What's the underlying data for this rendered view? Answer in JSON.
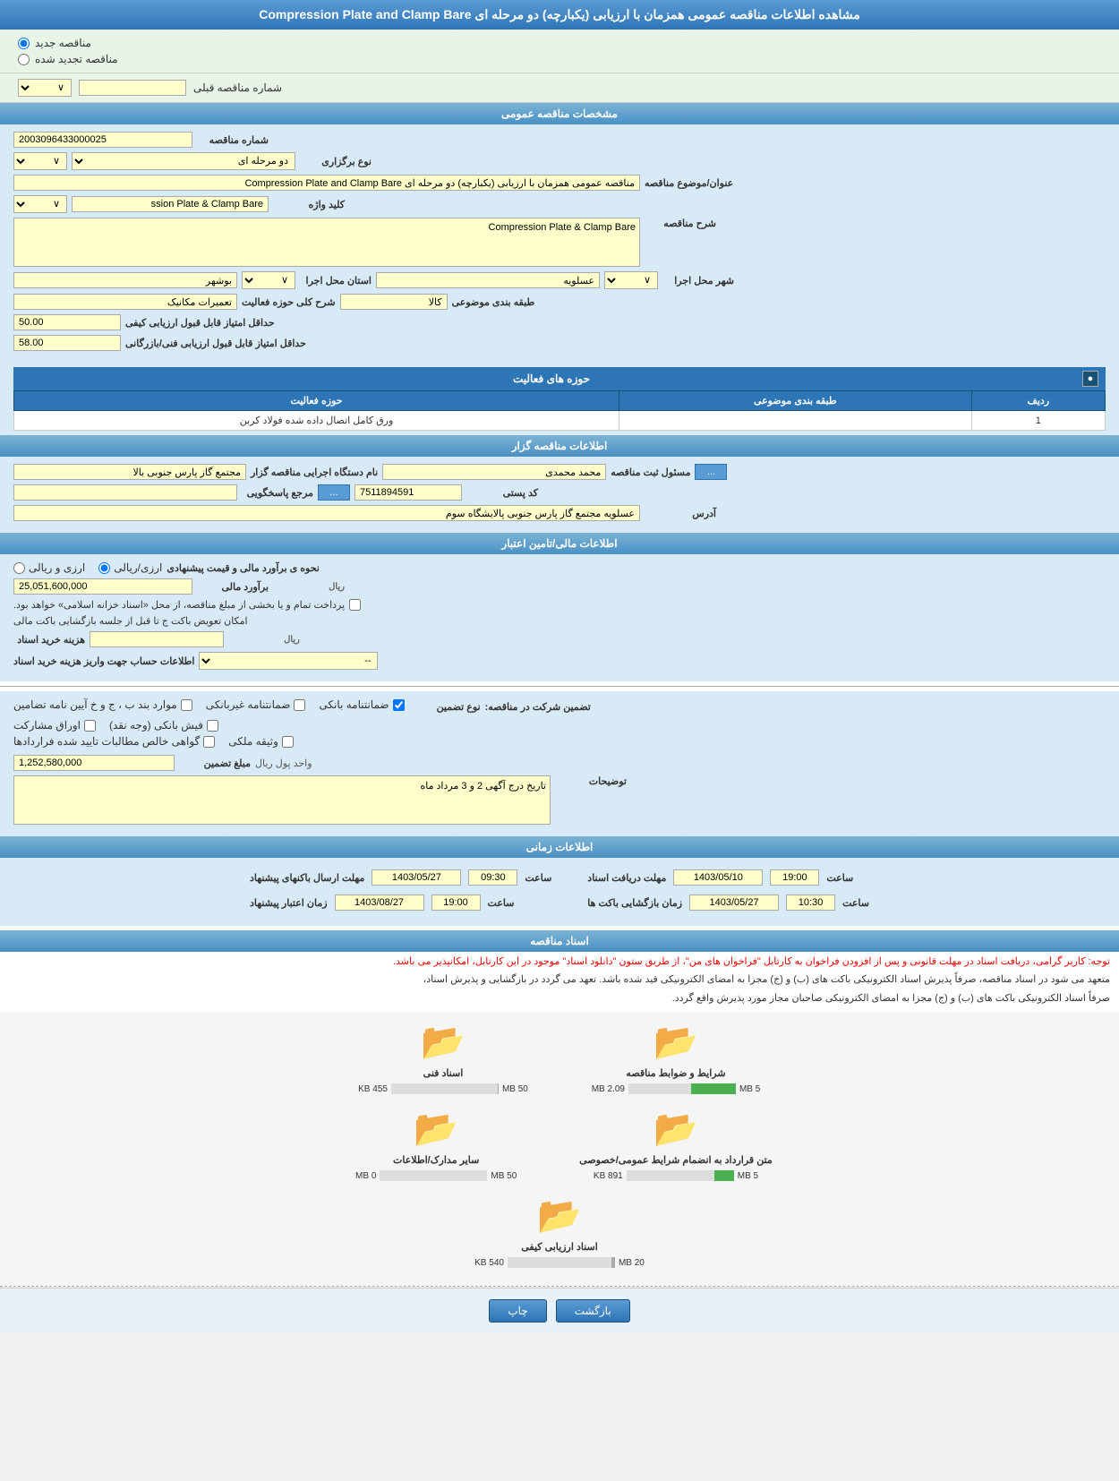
{
  "header": {
    "title": "مشاهده اطلاعات مناقصه عمومی همزمان با ارزیابی (یکبارچه) دو مرحله ای Compression Plate and Clamp Bare"
  },
  "top_radio": {
    "new_tender": "مناقصه جدید",
    "renewed_tender": "مناقصه تجدید شده",
    "prev_tender_label": "شماره مناقصه قبلی",
    "prev_tender_placeholder": "--"
  },
  "general_section": {
    "title": "مشخصات مناقصه عمومی",
    "tender_number_label": "شماره مناقصه",
    "tender_number_value": "2003096433000025",
    "tender_type_label": "نوع برگزاری",
    "tender_type_value": "دو مرحله ای",
    "tender_title_label": "عنوان/موضوع مناقصه",
    "tender_title_value": "مناقصه عمومی همزمان با ارزیابی (یکبارچه) دو مرحله ای Compression Plate and Clamp Bare",
    "keyword_label": "کلید واژه",
    "keyword_value": "ssion Plate & Clamp Bare",
    "description_label": "شرح مناقصه",
    "description_value": "Compression Plate & Clamp Bare",
    "province_label": "استان محل اجرا",
    "province_value": "بوشهر",
    "city_label": "شهر محل اجرا",
    "city_value": "عسلویه",
    "activity_domain_label": "شرح کلی حوزه فعالیت",
    "activity_domain_value": "تعمیرات مکانیک",
    "product_category_label": "طبقه بندی موضوعی",
    "product_category_value": "کالا",
    "min_quality_score_label": "حداقل امتیاز قابل قبول ارزیابی کیفی",
    "min_quality_score_value": "50.00",
    "min_financial_score_label": "حداقل امتیاز قابل قبول ارزیابی فنی/بازرگانی",
    "min_financial_score_value": "58.00"
  },
  "activity_section": {
    "title": "حوزه های فعالیت",
    "collapse_symbol": "●",
    "table_headers": [
      "ردیف",
      "طبقه بندی موضوعی",
      "حوزه فعالیت"
    ],
    "table_rows": [
      {
        "row": "1",
        "category": "",
        "activity": "ورق کامل اتصال داده شده فولاد کربن"
      }
    ]
  },
  "organizer_section": {
    "title": "اطلاعات مناقصه گزار",
    "org_name_label": "نام دستگاه اجرایی مناقصه گزار",
    "org_name_value": "مجتمع گاز پارس جنوبی بالا",
    "responsible_label": "مسئول ثبت مناقصه",
    "responsible_value": "محمد محمدی",
    "reference_label": "مرجع پاسخگویی",
    "postal_code_label": "کد پستی",
    "postal_code_value": "7511894591",
    "address_label": "آدرس",
    "address_value": "عسلویه مجتمع گاز پارس جنوبی پالایشگاه سوم",
    "btn_dots": "..."
  },
  "financial_section": {
    "title": "اطلاعات مالی/تامین اعتبار",
    "estimate_type_label": "نحوه ی برآورد مالی و قیمت پیشنهادی",
    "option_rial": "ارزی/ریالی",
    "option_rial_rial": "ارزی و ریالی",
    "estimate_label": "برآورد مالی",
    "estimate_value": "25,051,600,000",
    "estimate_currency": "ریال",
    "payment_note": "امکان تعویض باکت ج تا قبل از جلسه بازگشایی باکت مالی",
    "payment_detail": "پرداخت تمام و یا بخشی از مبلغ مناقصه، از محل «اسناد خزانه اسلامی» خواهد بود.",
    "expense_label": "هزینه خرید اسناد",
    "expense_currency": "ریال",
    "account_info_label": "اطلاعات حساب جهت واریز هزینه خرید اسناد",
    "account_info_value": "--"
  },
  "guarantee_section": {
    "participation_label": "تضمین شرکت در مناقصه:",
    "guarantee_type_label": "نوع تضمین",
    "guarantee_types": [
      "ضمانتنامه بانکی",
      "ضمانتنامه غیربانکی",
      "موارد بند ب، ج و خ آیین نامه تضامین",
      "فیش بانکی (وجه نقد)",
      "اوراق مشارکت",
      "وثیقه ملکی",
      "گواهی خالص مطالبات تایید شده قراردادها"
    ],
    "amount_label": "مبلغ تضمین",
    "amount_value": "1,252,580,000",
    "amount_currency": "واحد پول ریال",
    "description_label": "توضیحات",
    "description_value": "تاریخ درج آگهی 2 و 3 مرداد ماه"
  },
  "timing_section": {
    "title": "اطلاعات زمانی",
    "doc_deadline_label": "مهلت دریافت اسناد",
    "doc_deadline_date": "1403/05/10",
    "doc_deadline_time": "19:00",
    "doc_deadline_time_label": "ساعت",
    "submit_deadline_label": "مهلت ارسال باکنهای پیشنهاد",
    "submit_deadline_date": "1403/05/27",
    "submit_deadline_time": "09:30",
    "submit_deadline_time_label": "ساعت",
    "opening_date_label": "زمان بازگشایی باکت ها",
    "opening_date": "1403/05/27",
    "opening_time": "10:30",
    "opening_time_label": "ساعت",
    "validity_label": "زمان اعتبار پیشنهاد",
    "validity_date": "1403/08/27",
    "validity_time": "19:00",
    "validity_time_label": "ساعت"
  },
  "notice_section": {
    "notice_red": "توجه: کاربر گرامی، دریافت اسناد در مهلت قانونی و پس از افزودن فراخوان به کارتابل \"فراخوان های من\"، از طریق ستون \"دانلود اسناد\" موجود در این کارتابل، امکانپذیر می باشد.",
    "notice_black1": "متعهد می شود در اسناد مناقصه، صرفاً پذیرش اسناد الکترونیکی باکت های (ب) و (ج) مجزا به امضای الکترونیکی قید شده باشد. تعهد می گردد در بازگشایی و پذیرش اسناد،",
    "notice_black2": "صرفاً اسناد الکترونیکی باکت های (ب) و (ج) مجزا به امضای الکترونیکی صاحبان مجاز مورد پذیرش واقع گردد."
  },
  "files_section": {
    "title": "اسناد مناقصه",
    "files": [
      {
        "name": "شرایط و ضوابط مناقصه",
        "size_used": "2.09 MB",
        "size_max": "5 MB",
        "bar_percent": 42,
        "bar_color": "#4caf50"
      },
      {
        "name": "اسناد فنی",
        "size_used": "455 KB",
        "size_max": "50 MB",
        "bar_percent": 1,
        "bar_color": "#aaa"
      },
      {
        "name": "متن قرارداد به انضمام شرایط عمومی/خصوصی",
        "size_used": "891 KB",
        "size_max": "5 MB",
        "bar_percent": 18,
        "bar_color": "#4caf50"
      },
      {
        "name": "سایر مدارک/اطلاعات",
        "size_used": "0 MB",
        "size_max": "50 MB",
        "bar_percent": 0,
        "bar_color": "#aaa"
      },
      {
        "name": "اسناد ارزیابی کیفی",
        "size_used": "540 KB",
        "size_max": "20 MB",
        "bar_percent": 3,
        "bar_color": "#aaa"
      }
    ]
  },
  "bottom_buttons": {
    "print_label": "چاپ",
    "back_label": "بازگشت"
  }
}
